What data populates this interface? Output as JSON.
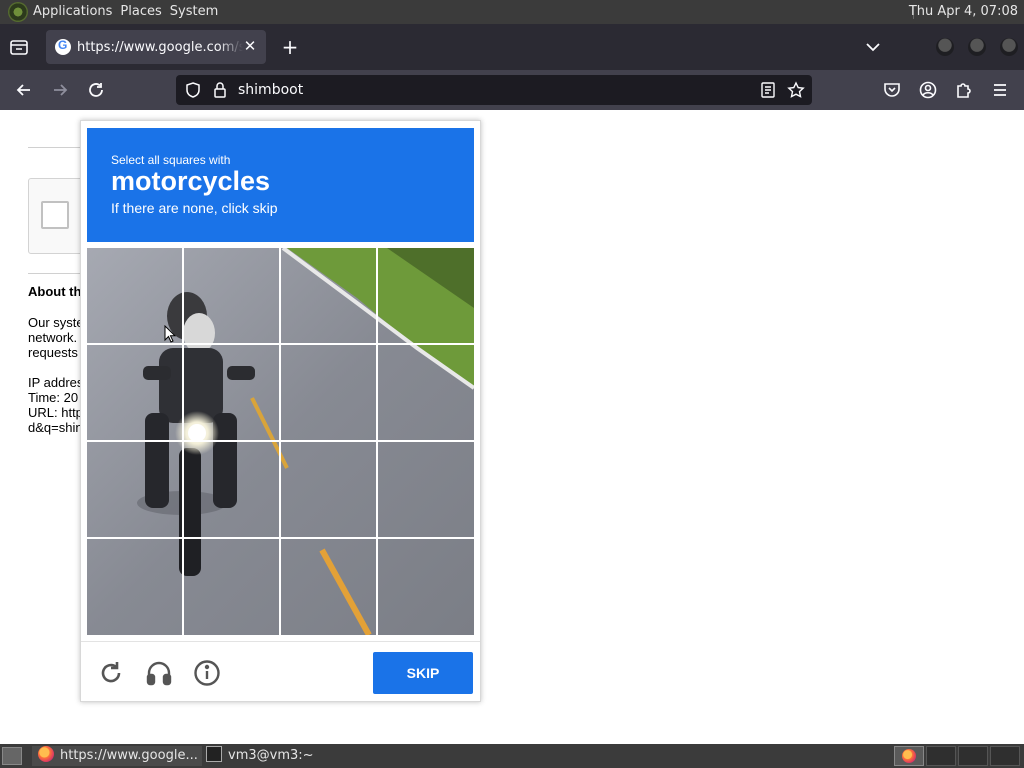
{
  "top_panel": {
    "menus": [
      "Applications",
      "Places",
      "System"
    ],
    "clock": "Thu Apr  4, 07:08"
  },
  "browser": {
    "tab": {
      "title": "https://www.google.com/sorry/index"
    },
    "url": "shimboot"
  },
  "page": {
    "about_heading": "About th",
    "lines": [
      "Our syste",
      "network.",
      "requests",
      "",
      "IP addres",
      "Time: 20",
      "URL: http",
      "d&q=shin"
    ]
  },
  "captcha": {
    "instruction": "Select all squares with",
    "target": "motorcycles",
    "hint": "If there are none, click skip",
    "skip_label": "SKIP",
    "header_color": "#1a73e8",
    "grid": {
      "rows": 4,
      "cols": 4
    }
  },
  "taskbar": {
    "tasks": [
      "https://www.google...",
      "vm3@vm3:~"
    ]
  }
}
